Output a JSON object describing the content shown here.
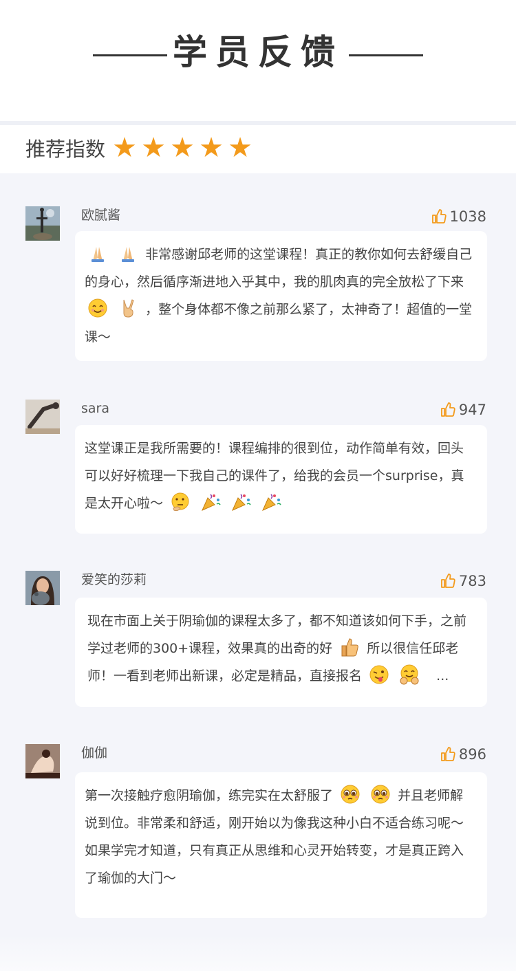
{
  "header": {
    "title": "学员反馈"
  },
  "rating": {
    "label": "推荐指数",
    "stars": 5,
    "accent": "#f39a1b"
  },
  "reviews": [
    {
      "name": "欧腻酱",
      "likes": "1038",
      "avatar_icon": "yoga-pose-avatar",
      "text_1": "非常感谢邱老师的这堂课程！真正的教你如何去舒缓自己的身心，然后循序渐进地入乎其中，我的肌肉真的完全放松了下来",
      "text_2": "，整个身体都不像之前那么紧了，太神奇了！超值的一堂课～"
    },
    {
      "name": "sara",
      "likes": "947",
      "avatar_icon": "stretch-pose-avatar",
      "text_1": "这堂课正是我所需要的！课程编排的很到位，动作简单有效，回头可以好好梳理一下我自己的课件了，给我的会员一个surprise，真是太开心啦～"
    },
    {
      "name": "爱笑的莎莉",
      "likes": "783",
      "avatar_icon": "woman-with-cat-avatar",
      "text_1": "现在市面上关于阴瑜伽的课程太多了，都不知道该如何下手，之前学过老师的300+课程，效果真的出奇的好",
      "text_2": "所以很信任邱老师！一看到老师出新课，必定是精品，直接报名",
      "text_3": "..."
    },
    {
      "name": "伽伽",
      "likes": "896",
      "avatar_icon": "seated-pose-avatar",
      "text_1": "第一次接触疗愈阴瑜伽，练完实在太舒服了",
      "text_2": "并且老师解说到位。非常柔和舒适，刚开始以为像我这种小白不适合练习呢～如果学完才知道，只有真正从思维和心灵开始转变，才是真正跨入了瑜伽的大门～"
    }
  ]
}
